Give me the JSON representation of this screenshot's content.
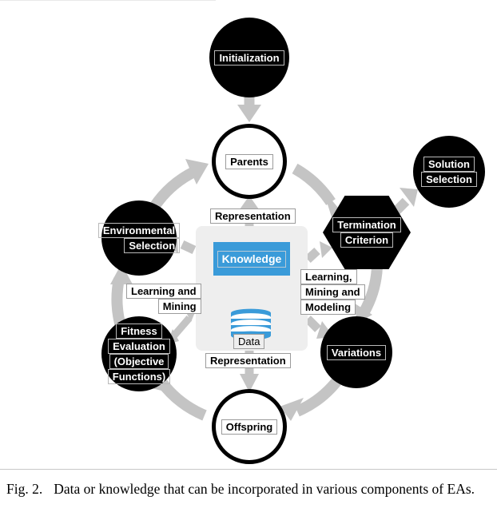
{
  "figure": {
    "caption_label": "Fig. 2.",
    "caption_text": "Data or knowledge that can be incorporated in various components of EAs."
  },
  "nodes": {
    "initialization": {
      "label": "Initialization",
      "shape": "circle",
      "fill": "#000000",
      "text_color": "#ffffff"
    },
    "parents": {
      "label": "Parents",
      "shape": "circle",
      "fill": "#ffffff",
      "text_color": "#000000"
    },
    "environmental_selection": {
      "line1": "Environmental",
      "line2": "Selection",
      "shape": "circle",
      "fill": "#000000",
      "text_color": "#ffffff"
    },
    "fitness_evaluation": {
      "line1": "Fitness",
      "line2": "Evaluation",
      "line3": "(Objective",
      "line4": "Functions)",
      "shape": "circle",
      "fill": "#000000",
      "text_color": "#ffffff"
    },
    "offspring": {
      "label": "Offspring",
      "shape": "circle",
      "fill": "#ffffff",
      "text_color": "#000000"
    },
    "variations": {
      "label": "Variations",
      "shape": "circle",
      "fill": "#000000",
      "text_color": "#ffffff"
    },
    "termination_criterion": {
      "line1": "Termination",
      "line2": "Criterion",
      "shape": "hexagon",
      "fill": "#000000",
      "text_color": "#ffffff"
    },
    "solution_selection": {
      "line1": "Solution",
      "line2": "Selection",
      "shape": "circle",
      "fill": "#000000",
      "text_color": "#ffffff"
    }
  },
  "center": {
    "knowledge_label": "Knowledge",
    "knowledge_color": "#3a9bd9",
    "data_label": "Data",
    "panel_color": "#eeeeee"
  },
  "edge_labels": {
    "representation_top": "Representation",
    "representation_bottom": "Representation",
    "learning_mining_l1": "Learning and",
    "learning_mining_l2": "Mining",
    "learning_mining_modeling_l1": "Learning,",
    "learning_mining_modeling_l2": "Mining and",
    "learning_mining_modeling_l3": "Modeling"
  },
  "colors": {
    "arrow_gray": "#c4c4c4",
    "accent_blue": "#3a9bd9",
    "panel_gray": "#eeeeee"
  }
}
